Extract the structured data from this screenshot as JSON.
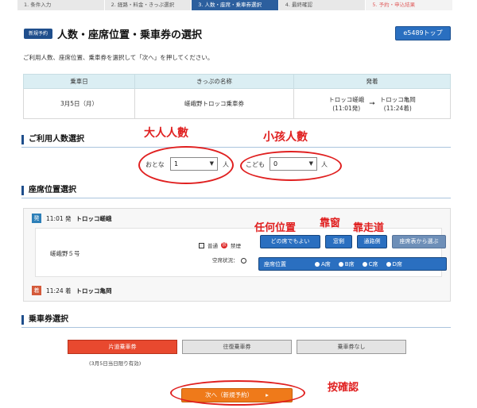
{
  "steps": [
    "1. 条件入力",
    "2. 経路・料金・きっぷ選択",
    "3. 人数・座席・乗車券選択",
    "4. 最終確認",
    "5. 予約・申込結果"
  ],
  "header": {
    "badge": "新規予約",
    "title": "人数・座席位置・乗車券の選択",
    "top_button": "e5489トップ"
  },
  "instruction": "ご利用人数、座席位置、乗車券を選択して「次へ」を押してください。",
  "ticket_table": {
    "headers": [
      "乗車日",
      "きっぷの名称",
      "発着"
    ],
    "date": "3月5日（月）",
    "ticket_name": "嵯峨野トロッコ乗車券",
    "departure": {
      "station": "トロッコ嵯峨",
      "time": "(11:01発)"
    },
    "arrival": {
      "station": "トロッコ亀岡",
      "time": "(11:24着)"
    }
  },
  "passenger_section": {
    "title": "ご利用人数選択",
    "adult_label": "おとな",
    "adult_value": "1",
    "child_label": "こども",
    "child_value": "0",
    "unit": "人"
  },
  "seat_section": {
    "title": "座席位置選択",
    "departure_row": {
      "badge": "発",
      "time": "11:01 発",
      "station": "トロッコ嵯峨"
    },
    "car_name": "嵯峨野５号",
    "legend_regular": "普通",
    "legend_no_smoking_icon": "禁",
    "legend_no_smoking": "禁煙",
    "vacancy_label": "空席状況：",
    "buttons": [
      "どの席でもよい",
      "窓側",
      "通路側",
      "座席表から選ぶ"
    ],
    "position_label": "座席位置",
    "position_options": [
      "A席",
      "B席",
      "C席",
      "D席"
    ],
    "arrival_row": {
      "badge": "着",
      "time": "11:24 着",
      "station": "トロッコ亀岡"
    }
  },
  "ticket_section": {
    "title": "乗車券選択",
    "options": [
      "片道乗車券",
      "往復乗車券",
      "乗車券なし"
    ],
    "note": "(3月5日当日限り有効)"
  },
  "next_button": "次へ（新規予約）",
  "next_chevron": "▸",
  "annotations": {
    "adult": "大人人數",
    "child": "小孩人數",
    "any_seat": "任何位置",
    "window": "靠窗",
    "aisle": "靠走道",
    "confirm": "按確認"
  },
  "colors": {
    "accent": "#2a6fc0",
    "selected_ticket": "#e8492f",
    "next": "#ef7a1a",
    "annotation": "#e02020"
  }
}
